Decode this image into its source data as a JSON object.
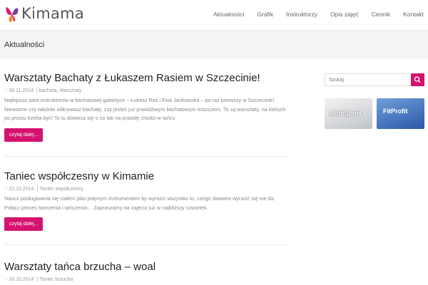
{
  "header": {
    "logo_text": "Kimama",
    "nav": [
      "Aktualności",
      "Grafik",
      "Instruktorzy",
      "Opis zajęć",
      "Cennik",
      "Kontakt"
    ]
  },
  "page": {
    "title": "Aktualności"
  },
  "posts": [
    {
      "title": "Warsztaty Bachaty z Łukaszem Rasiem w Szczecinie!",
      "date": "06.11.2014",
      "categories": "bachata, Warsztaty",
      "excerpt": "Najlepsza para instruktorów w bachatowej galaktyce – Łukasz Raś i Ewa Jankowska – po raz pierwszy w Szczecinie! Nieważne czy właśnie odkrywasz bachatę, czy jesteś już prawdziwym bachatowym miszczem. To są warsztaty, na których po prostu trzeba być! To tu dowiesz się o co tak na prawdę chodzi w tańcu",
      "button": "czytaj dalej..."
    },
    {
      "title": "Taniec współczesny w Kimamie",
      "date": "31.10.2014",
      "categories": "Taniec współczesny",
      "excerpt": "Naucz posługiwania się ciałem jako jedynym instrumentem by wyrazić wszystko to, czego słowami wyrazić się nie da. Połącz proces tworzenia i tańczenia… Zapraszamy na zajęcia już w najbliższy czwartek.",
      "button": "czytaj dalej..."
    },
    {
      "title": "Warsztaty tańca brzucha – woal",
      "date": "28.10.2014",
      "categories": "Taniec brzucha"
    }
  ],
  "sidebar": {
    "search_placeholder": "Szukaj",
    "banner1_text": "MultiSport",
    "banner2_text": "FitProfit"
  },
  "colors": {
    "accent": "#d4136f"
  }
}
